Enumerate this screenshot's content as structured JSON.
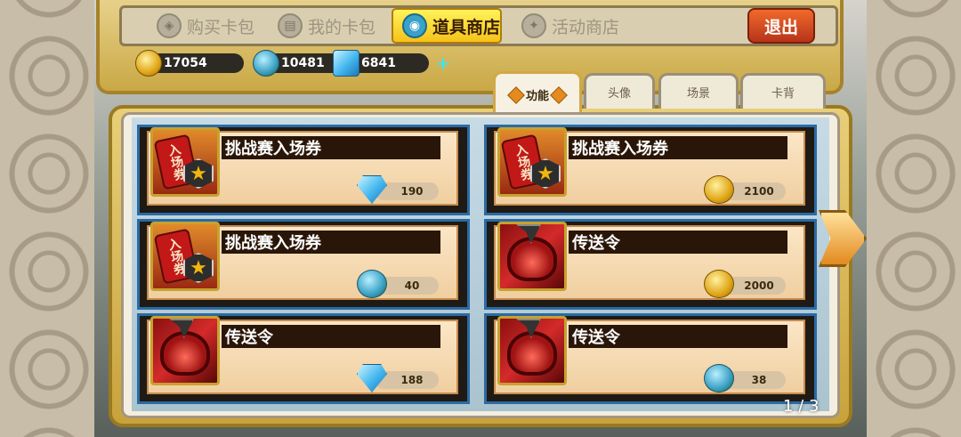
{
  "nav_tabs": [
    {
      "label": "购买卡包",
      "icon": "card-pack-icon",
      "active": false
    },
    {
      "label": "我的卡包",
      "icon": "card-deck-icon",
      "active": false
    },
    {
      "label": "道具商店",
      "icon": "token-icon",
      "active": true
    },
    {
      "label": "活动商店",
      "icon": "event-icon",
      "active": false
    }
  ],
  "exit_label": "退出",
  "currency": {
    "coins": "17054",
    "tokens": "10481",
    "gems": "6841",
    "plus": "+"
  },
  "category_tabs": [
    {
      "label": "功能",
      "active": true
    },
    {
      "label": "头像",
      "active": false
    },
    {
      "label": "场景",
      "active": false
    },
    {
      "label": "卡背",
      "active": false
    }
  ],
  "items": [
    {
      "name": "挑战赛入场券",
      "icon": "challenge-ticket-icon",
      "price": "190",
      "currency_icon": "gem-icon"
    },
    {
      "name": "挑战赛入场券",
      "icon": "challenge-ticket-icon",
      "price": "2100",
      "currency_icon": "coin-icon"
    },
    {
      "name": "挑战赛入场券",
      "icon": "challenge-ticket-icon",
      "price": "40",
      "currency_icon": "token-icon"
    },
    {
      "name": "传送令",
      "icon": "teleport-token-icon",
      "price": "2000",
      "currency_icon": "coin-icon"
    },
    {
      "name": "传送令",
      "icon": "teleport-token-icon",
      "price": "188",
      "currency_icon": "gem-icon"
    },
    {
      "name": "传送令",
      "icon": "teleport-token-icon",
      "price": "38",
      "currency_icon": "token-icon"
    }
  ],
  "ticket_glyph": "入场券",
  "page": "1 / 3",
  "colors": {
    "card_border": "#2b6aa3",
    "name_bar": "#2a1608",
    "frame_gold": "#c8a23c",
    "exit_red": "#b8341a"
  }
}
